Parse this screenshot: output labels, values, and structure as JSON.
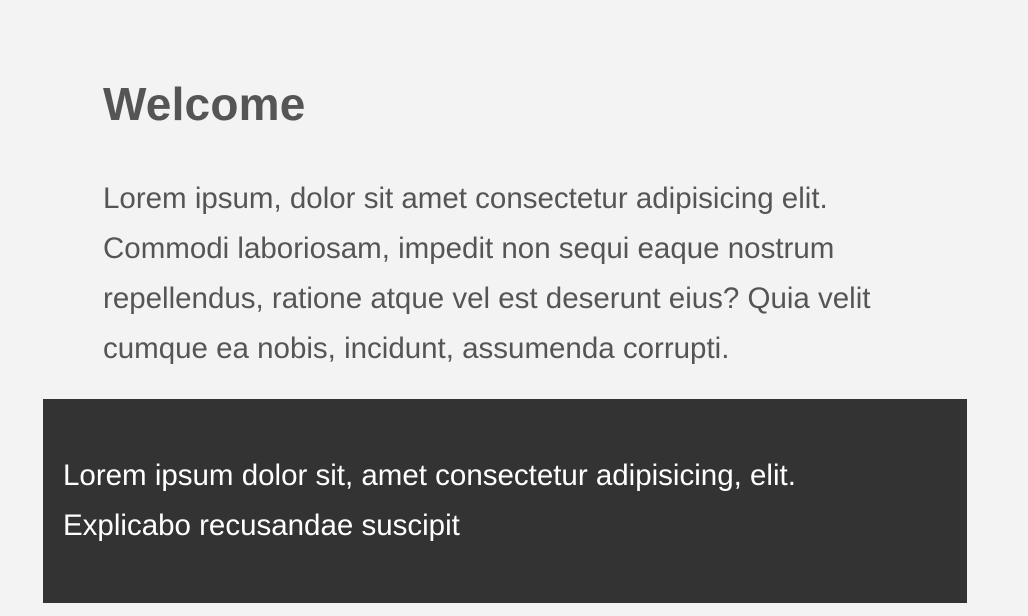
{
  "header": {
    "title": "Welcome"
  },
  "main": {
    "intro_text": "Lorem ipsum, dolor sit amet consectetur adipisicing elit. Commodi laboriosam, impedit non sequi eaque nostrum repellendus, ratione atque vel est deserunt eius? Quia velit cumque ea nobis, incidunt, assumenda corrupti."
  },
  "panel": {
    "text": "Lorem ipsum dolor sit, amet consectetur adipisicing, elit. Explicabo recusandae suscipit"
  },
  "colors": {
    "background": "#f3f3f3",
    "text": "#555555",
    "panel_background": "#333333",
    "panel_text": "#ffffff"
  }
}
